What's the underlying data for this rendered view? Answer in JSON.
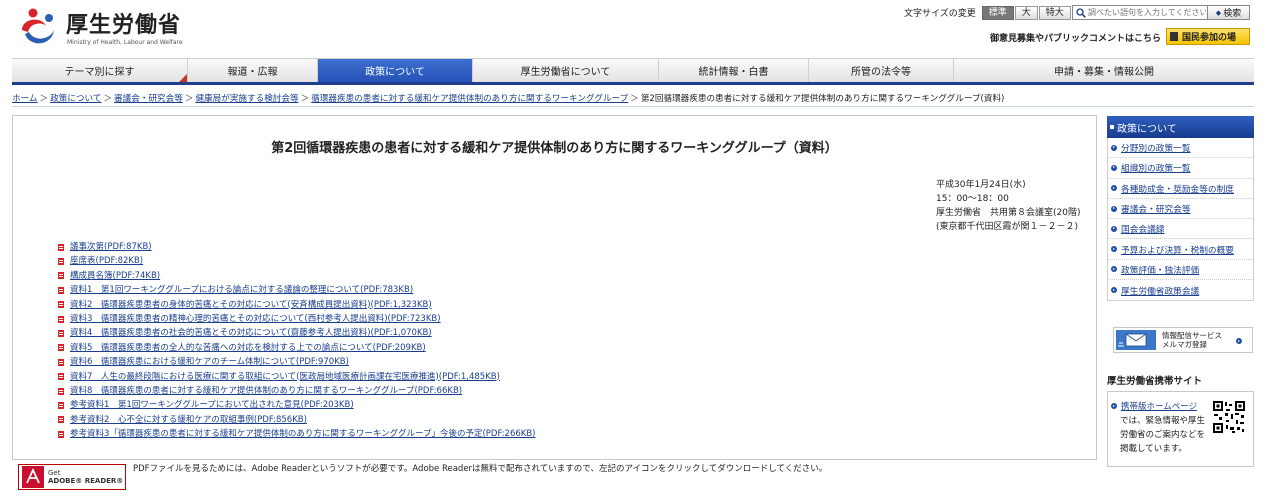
{
  "header": {
    "logo_title": "厚生労働省",
    "logo_subtitle": "Ministry of Health, Labour and Welfare",
    "font_size_label": "文字サイズの変更",
    "font_sizes": [
      "標準",
      "大",
      "特大"
    ],
    "search_placeholder": "調べたい語句を入力してください",
    "search_button": "検索",
    "opinion_link": "御意見募集やパブリックコメントはこちら",
    "participate_button": "国民参加の場"
  },
  "nav": {
    "items": [
      "テーマ別に探す",
      "報道・広報",
      "政策について",
      "厚生労働省について",
      "統計情報・白書",
      "所管の法令等",
      "申請・募集・情報公開"
    ]
  },
  "breadcrumb": {
    "links": [
      "ホーム",
      "政策について",
      "審議会・研究会等",
      "健康局が実施する検討会等",
      "循環器疾患の患者に対する緩和ケア提供体制のあり方に関するワーキンググループ"
    ],
    "current": "第2回循環器疾患の患者に対する緩和ケア提供体制のあり方に関するワーキンググループ(資料)"
  },
  "main": {
    "title": "第2回循環器疾患の患者に対する緩和ケア提供体制のあり方に関するワーキンググループ（資料）",
    "meta": [
      "平成30年1月24日(水)",
      "15：00～18：00",
      "厚生労働省　共用第８会議室(20階)",
      "(東京都千代田区霞が関１－２－２)"
    ],
    "documents": [
      "議事次第(PDF:87KB)",
      "座席表(PDF:82KB)",
      "構成員名簿(PDF:74KB)",
      "資料1　第1回ワーキンググループにおける論点に対する議論の整理について(PDF:783KB)",
      "資料2　循環器疾患患者の身体的苦痛とその対応について(安斉構成員提出資料)(PDF:1,323KB)",
      "資料3　循環器疾患患者の精神心理的苦痛とその対応について(西村参考人提出資料)(PDF:723KB)",
      "資料4　循環器疾患患者の社会的苦痛とその対応について(齋藤参考人提出資料)(PDF:1,070KB)",
      "資料5　循環器疾患患者の全人的な苦痛への対応を検討する上での論点について(PDF:209KB)",
      "資料6　循環器疾患における緩和ケアのチーム体制について(PDF:970KB)",
      "資料7　人生の最終段階における医療に関する取組について(医政局地域医療計画課在宅医療推進)(PDF:1,485KB)",
      "資料8　循環器疾患の患者に対する緩和ケア提供体制のあり方に関するワーキンググループ(PDF:66KB)",
      "参考資料1　第1回ワーキンググループにおいて出された意見(PDF:203KB)",
      "参考資料2　心不全に対する緩和ケアの取組事例(PDF:856KB)",
      "参考資料3「循環器疾患の患者に対する緩和ケア提供体制のあり方に関するワーキンググループ」今後の予定(PDF:266KB)"
    ],
    "reader_badge_top": "Get",
    "reader_badge_bottom": "ADOBE® READER®",
    "reader_note": "PDFファイルを見るためには、Adobe Readerというソフトが必要です。Adobe Readerは無料で配布されていますので、左記のアイコンをクリックしてダウンロードしてください。"
  },
  "sidebar": {
    "header": "政策について",
    "items": [
      "分野別の政策一覧",
      "組織別の政策一覧",
      "各種助成金・奨励金等の制度",
      "審議会・研究会等",
      "国会会議録",
      "予算および決算・税制の概要",
      "政策評価・独法評価",
      "厚生労働省政策会議"
    ],
    "mailmag_line1": "情報配信サービス",
    "mailmag_line2": "メルマガ登録",
    "mobile_title": "厚生労働省携帯サイト",
    "mobile_link": "携帯版ホームページ",
    "mobile_text": "では、緊急情報や厚生労働省のご案内などを掲載しています。"
  },
  "colors": {
    "nav_active": "#2f5fc0",
    "nav_border": "#1f3f8e",
    "link": "#1a3f8f",
    "participate": "#f5c400"
  }
}
